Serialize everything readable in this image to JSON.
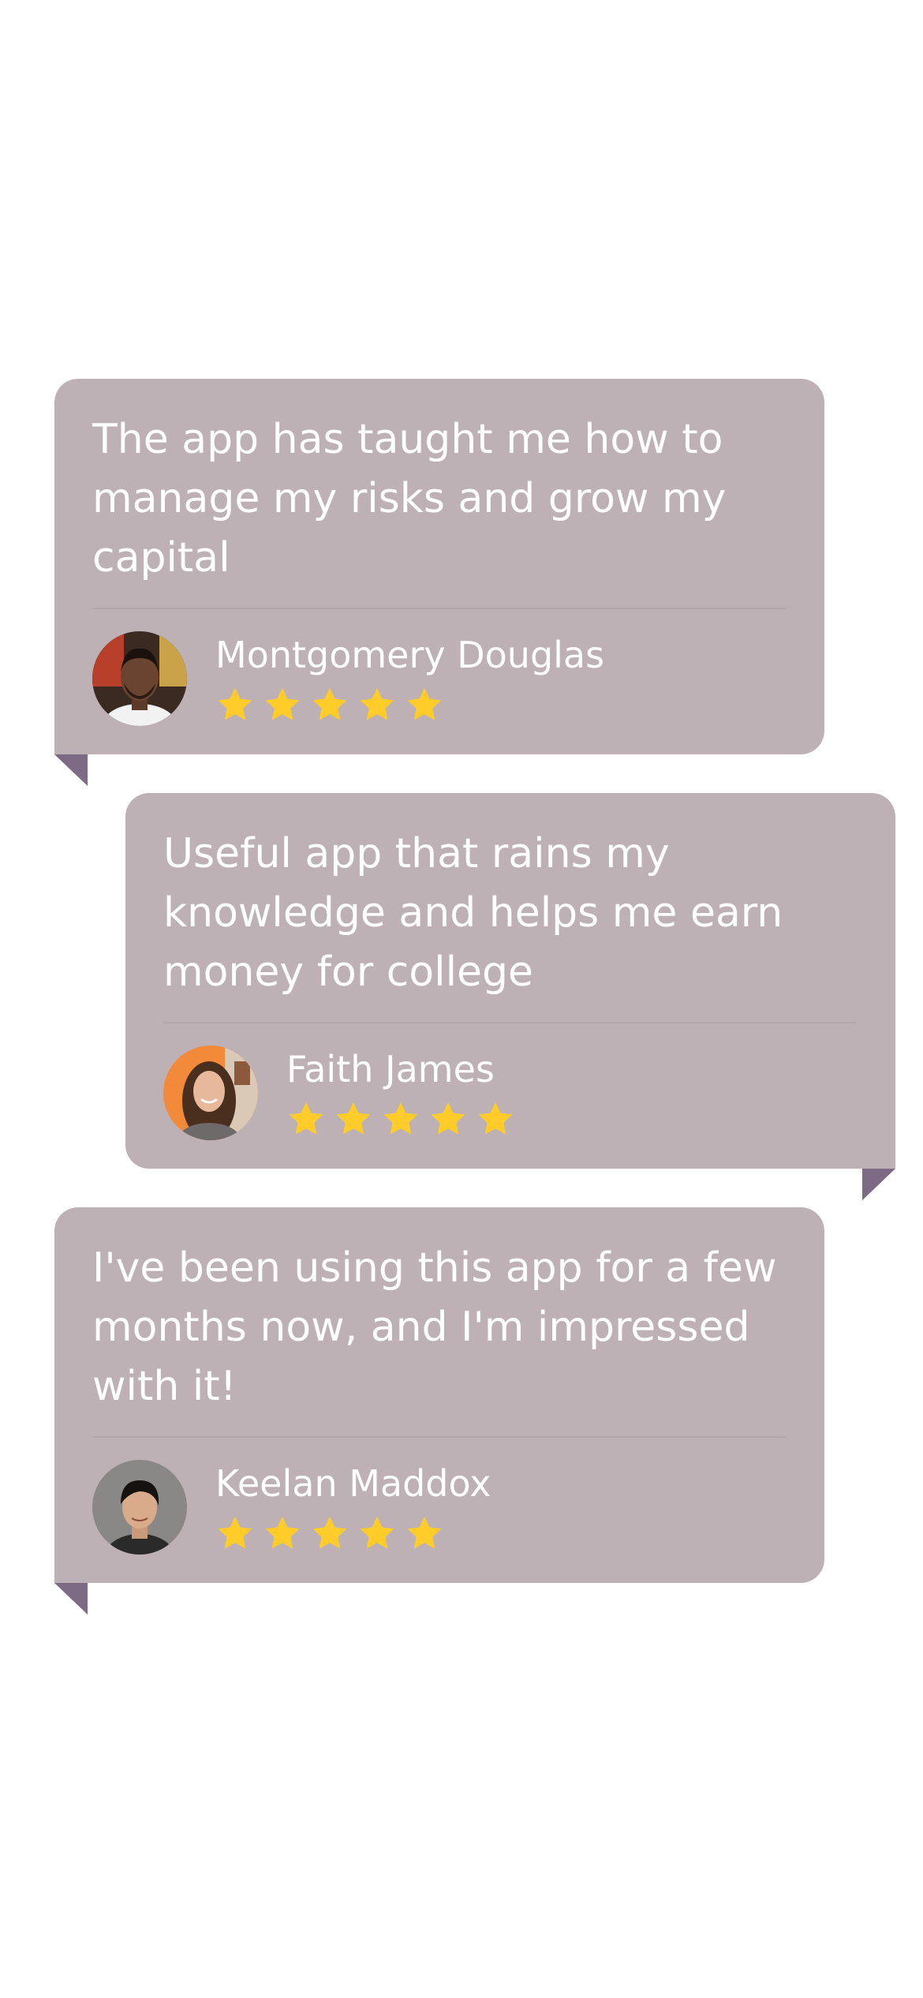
{
  "colors": {
    "card_background": "#bdb1b6",
    "tail": "#7d6a84",
    "star": "#ffcc29",
    "text": "#ffffff"
  },
  "testimonials": [
    {
      "quote": "The app has taught me how to manage  my risks and grow my capital",
      "name": "Montgomery Douglas",
      "rating": 5,
      "align": "left"
    },
    {
      "quote": "Useful app that rains my knowledge and helps me earn money for college",
      "name": "Faith James",
      "rating": 5,
      "align": "right"
    },
    {
      "quote": "I've been using this app for a few months now, and I'm impressed with it!",
      "name": "Keelan Maddox",
      "rating": 5,
      "align": "left"
    }
  ]
}
